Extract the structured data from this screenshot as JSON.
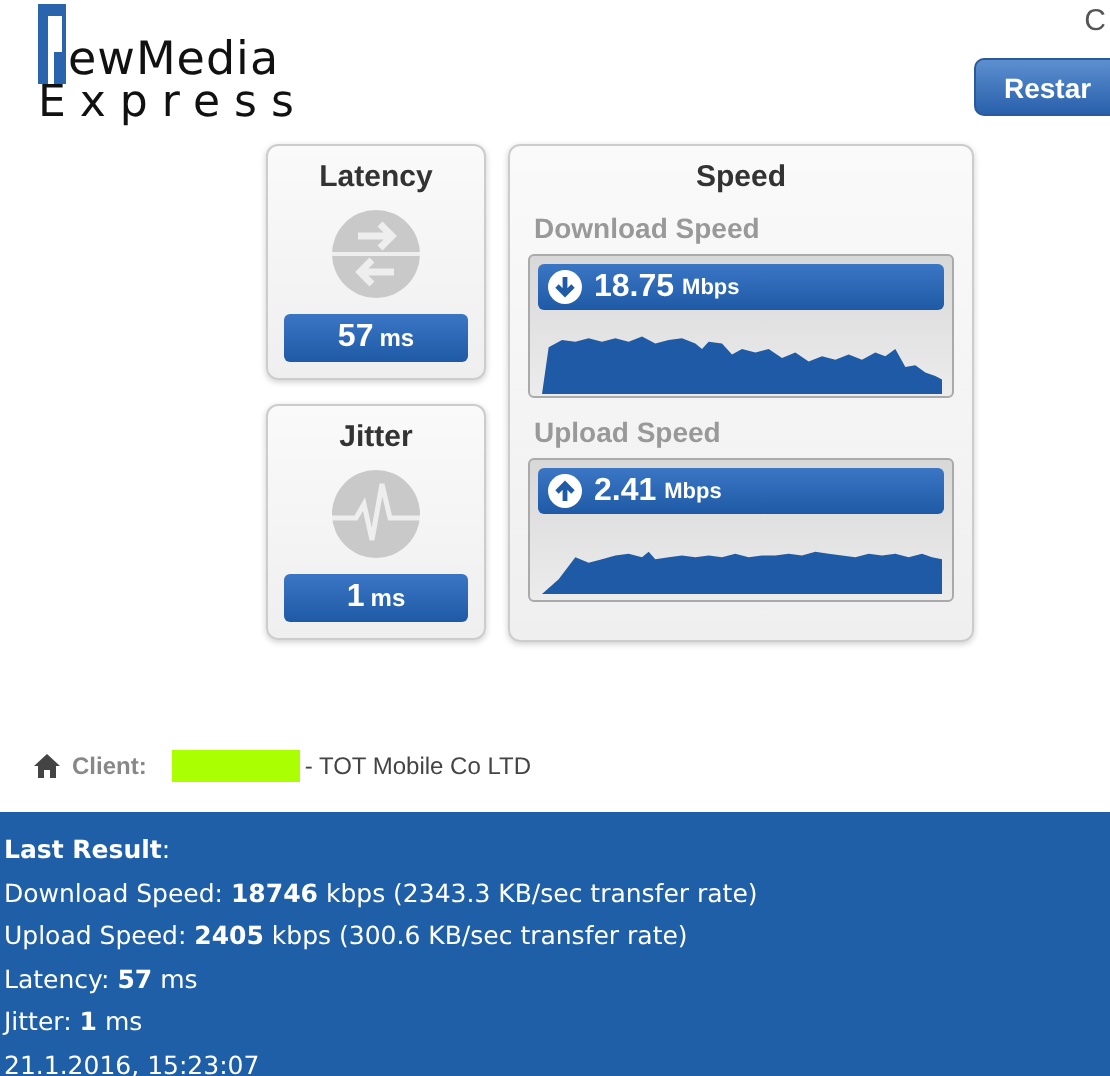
{
  "header": {
    "logo_line_1": "ewMedia",
    "logo_line_2": "Express",
    "corner_text": "C",
    "restart_button": "Restar"
  },
  "latency": {
    "title": "Latency",
    "value": "57",
    "unit": "ms"
  },
  "jitter": {
    "title": "Jitter",
    "value": "1",
    "unit": "ms"
  },
  "speed": {
    "title": "Speed",
    "download": {
      "label": "Download Speed",
      "value": "18.75",
      "unit": "Mbps"
    },
    "upload": {
      "label": "Upload Speed",
      "value": "2.41",
      "unit": "Mbps"
    }
  },
  "client": {
    "label": "Client:",
    "isp": "- TOT Mobile Co LTD"
  },
  "last_result": {
    "lines": [
      "**Last Result**:",
      "Download Speed: **18746** kbps (2343.3 KB/sec transfer rate)",
      "Upload Speed: **2405** kbps (300.6 KB/sec transfer rate)",
      "Latency: **57** ms",
      "Jitter: **1** ms",
      "21.1.2016, 15:23:07"
    ]
  }
}
